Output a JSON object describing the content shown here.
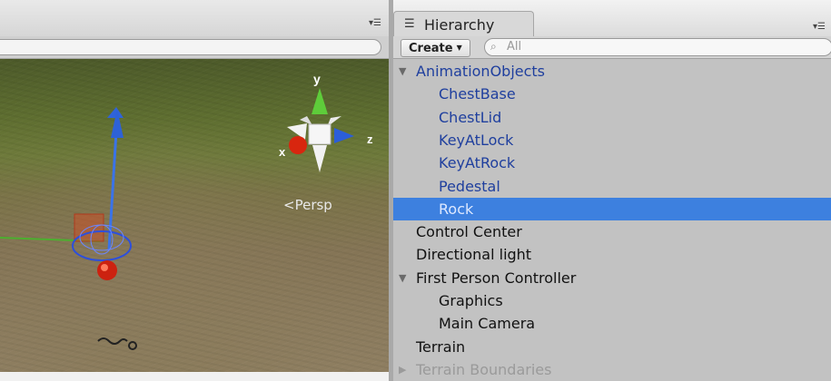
{
  "scene": {
    "persp_label": "Persp",
    "axis_labels": {
      "x": "x",
      "y": "y",
      "z": "z"
    }
  },
  "hierarchy": {
    "tab_title": "Hierarchy",
    "create_label": "Create",
    "search_placeholder": "All",
    "items": [
      {
        "label": "AnimationObjects",
        "depth": 0,
        "expanded": true,
        "color": "#1f3f9e"
      },
      {
        "label": "ChestBase",
        "depth": 1,
        "color": "#1f3f9e"
      },
      {
        "label": "ChestLid",
        "depth": 1,
        "color": "#1f3f9e"
      },
      {
        "label": "KeyAtLock",
        "depth": 1,
        "color": "#1f3f9e"
      },
      {
        "label": "KeyAtRock",
        "depth": 1,
        "color": "#1f3f9e"
      },
      {
        "label": "Pedestal",
        "depth": 1,
        "color": "#1f3f9e"
      },
      {
        "label": "Rock",
        "depth": 1,
        "selected": true
      },
      {
        "label": "Control Center",
        "depth": 0
      },
      {
        "label": "Directional light",
        "depth": 0
      },
      {
        "label": "First Person Controller",
        "depth": 0,
        "expanded": true
      },
      {
        "label": "Graphics",
        "depth": 1
      },
      {
        "label": "Main Camera",
        "depth": 1
      },
      {
        "label": "Terrain",
        "depth": 0
      },
      {
        "label": "Terrain Boundaries",
        "depth": 0,
        "collapsed": true
      }
    ]
  },
  "colors": {
    "selection": "#3d80df",
    "prefab_text": "#1f3f9e"
  }
}
